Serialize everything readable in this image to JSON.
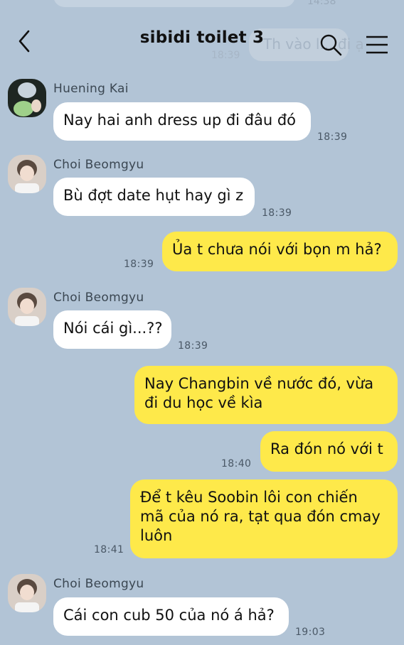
{
  "header": {
    "title": "sibidi toilet 3",
    "back_icon": "chevron-left-icon",
    "search_icon": "search-icon",
    "menu_icon": "menu-icon"
  },
  "ghost": {
    "top_time": "14:38",
    "partial_message": "Th vào l... đi ạ",
    "partial_time": "18:39"
  },
  "colors": {
    "background": "#b2c4d6",
    "incoming_bubble": "#ffffff",
    "outgoing_bubble": "#fee94a"
  },
  "messages": [
    {
      "sender": "Huening Kai",
      "text": "Nay hai anh dress up đi đâu đó",
      "time": "18:39"
    },
    {
      "sender": "Choi Beomgyu",
      "text": "Bù đợt date hụt hay gì z",
      "time": "18:39"
    },
    {
      "text": "Ủa t chưa nói với bọn m hả?",
      "time": "18:39"
    },
    {
      "sender": "Choi Beomgyu",
      "text": "Nói cái gì...??",
      "time": "18:39"
    },
    {
      "lines": [
        "Nay Changbin về nước đó, vừa",
        "đi du học về kìa"
      ]
    },
    {
      "text": "Ra đón nó với t",
      "time": "18:40"
    },
    {
      "lines": [
        "Để t kêu Soobin lôi con chiến",
        "mã của nó ra, tạt qua đón cmay",
        "luôn"
      ],
      "time": "18:41"
    },
    {
      "sender": "Choi Beomgyu",
      "text": "Cái con cub 50 của nó á hả?",
      "time": "19:03"
    }
  ]
}
